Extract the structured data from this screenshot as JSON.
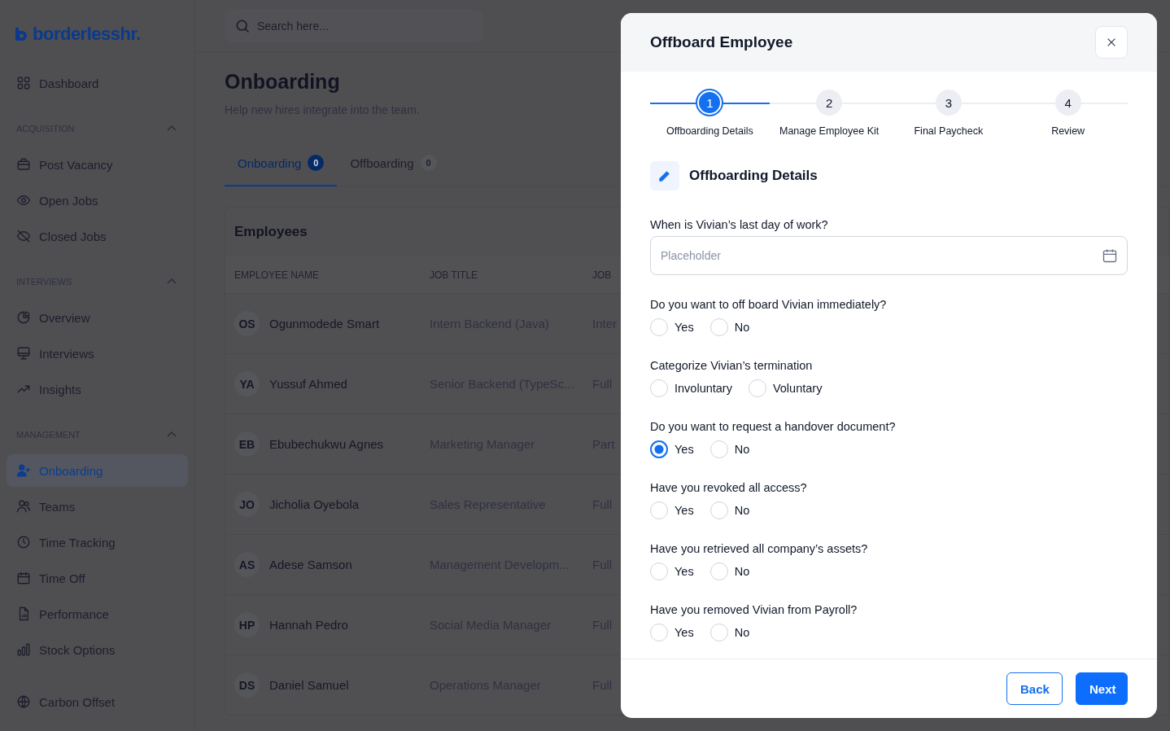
{
  "logo": "borderlesshr.",
  "sidebar": [
    {
      "kind": "item",
      "label": "Dashboard",
      "selected": false
    },
    {
      "kind": "section",
      "label": "ACQUISITION",
      "expanded": true
    },
    {
      "kind": "item",
      "label": "Post Vacancy",
      "selected": false
    },
    {
      "kind": "item",
      "label": "Open Jobs",
      "selected": false
    },
    {
      "kind": "item",
      "label": "Closed Jobs",
      "selected": false
    },
    {
      "kind": "section",
      "label": "INTERVIEWS",
      "expanded": true
    },
    {
      "kind": "item",
      "label": "Overview",
      "selected": false
    },
    {
      "kind": "item",
      "label": "Interviews",
      "selected": false
    },
    {
      "kind": "item",
      "label": "Insights",
      "selected": false
    },
    {
      "kind": "section",
      "label": "MANAGEMENT",
      "expanded": true
    },
    {
      "kind": "item",
      "label": "Onboarding",
      "selected": true
    },
    {
      "kind": "item",
      "label": "Teams",
      "selected": false
    },
    {
      "kind": "item",
      "label": "Time Tracking",
      "selected": false
    },
    {
      "kind": "item",
      "label": "Time Off",
      "selected": false
    },
    {
      "kind": "item",
      "label": "Performance",
      "selected": false
    },
    {
      "kind": "item",
      "label": "Stock Options",
      "selected": false
    },
    {
      "kind": "gap"
    },
    {
      "kind": "item",
      "label": "Carbon Offset",
      "selected": false
    }
  ],
  "search": {
    "placeholder": "Search here..."
  },
  "page": {
    "title": "Onboarding",
    "subtitle": "Help new hires integrate into the team."
  },
  "tabs": [
    {
      "label": "Onboarding",
      "count": "0",
      "selected": true
    },
    {
      "label": "Offboarding",
      "count": "0",
      "selected": false
    }
  ],
  "table": {
    "title": "Employees",
    "columns": [
      "EMPLOYEE NAME",
      "JOB TITLE",
      "JOB"
    ],
    "rows": [
      {
        "initials": "OS",
        "name": "Ogunmodede Smart",
        "job_title": "Intern Backend (Java)",
        "column_3": "Inter"
      },
      {
        "initials": "YA",
        "name": "Yussuf Ahmed",
        "job_title": "Senior Backend (TypeSc...",
        "column_3": "Full"
      },
      {
        "initials": "EB",
        "name": "Ebubechukwu Agnes",
        "job_title": "Marketing Manager",
        "column_3": "Part"
      },
      {
        "initials": "JO",
        "name": "Jicholia Oyebola",
        "job_title": "Sales Representative",
        "column_3": "Full"
      },
      {
        "initials": "AS",
        "name": "Adese Samson",
        "job_title": "Management Developm...",
        "column_3": "Full"
      },
      {
        "initials": "HP",
        "name": "Hannah Pedro",
        "job_title": "Social Media Manager",
        "column_3": "Full"
      },
      {
        "initials": "DS",
        "name": "Daniel Samuel",
        "job_title": "Operations Manager",
        "column_3": "Full"
      }
    ]
  },
  "modal": {
    "title": "Offboard Employee",
    "steps": [
      {
        "number": "1",
        "label": "Offboarding Details",
        "selected": true
      },
      {
        "number": "2",
        "label": "Manage Employee Kit",
        "selected": false
      },
      {
        "number": "3",
        "label": "Final Paycheck",
        "selected": false
      },
      {
        "number": "4",
        "label": "Review",
        "selected": false
      }
    ],
    "section_title": "Offboarding Details",
    "date_field": {
      "label": "When is Vivian’s last day of work?",
      "placeholder": "Placeholder"
    },
    "questions": [
      {
        "label": "Do you want to off board Vivian immediately?",
        "options": [
          {
            "label": "Yes",
            "selected": false
          },
          {
            "label": "No",
            "selected": false
          }
        ]
      },
      {
        "label": "Categorize Vivian’s termination",
        "options": [
          {
            "label": "Involuntary",
            "selected": false
          },
          {
            "label": "Voluntary",
            "selected": false
          }
        ]
      },
      {
        "label": "Do you want to request a handover document?",
        "options": [
          {
            "label": "Yes",
            "selected": true
          },
          {
            "label": "No",
            "selected": false
          }
        ]
      },
      {
        "label": "Have you revoked all access?",
        "options": [
          {
            "label": "Yes",
            "selected": false
          },
          {
            "label": "No",
            "selected": false
          }
        ]
      },
      {
        "label": "Have you retrieved all company’s assets?",
        "options": [
          {
            "label": "Yes",
            "selected": false
          },
          {
            "label": "No",
            "selected": false
          }
        ]
      },
      {
        "label": "Have you removed Vivian from Payroll?",
        "options": [
          {
            "label": "Yes",
            "selected": false
          },
          {
            "label": "No",
            "selected": false
          }
        ]
      }
    ],
    "buttons": {
      "back": "Back",
      "next": "Next"
    }
  }
}
